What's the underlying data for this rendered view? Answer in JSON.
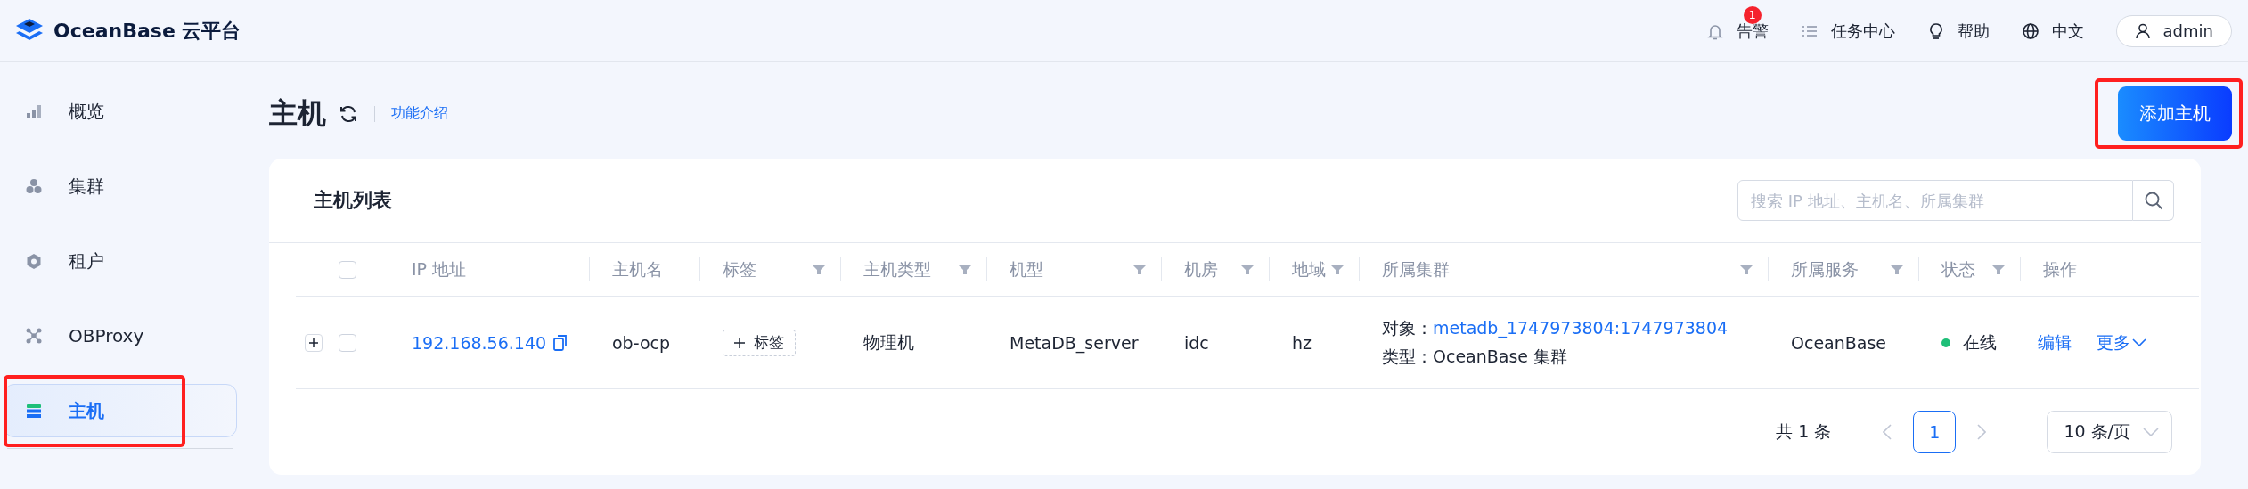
{
  "header": {
    "brand": "OceanBase 云平台",
    "actions": [
      {
        "kind": "alert",
        "label": "告警",
        "badge": "1"
      },
      {
        "kind": "tasks",
        "label": "任务中心"
      },
      {
        "kind": "help",
        "label": "帮助"
      },
      {
        "kind": "language",
        "label": "中文"
      }
    ],
    "user": "admin"
  },
  "sidebar": {
    "items": [
      {
        "kind": "overview",
        "label": "概览",
        "selected": false,
        "highlighted": false
      },
      {
        "kind": "cluster",
        "label": "集群",
        "selected": false,
        "highlighted": false
      },
      {
        "kind": "tenant",
        "label": "租户",
        "selected": false,
        "highlighted": false
      },
      {
        "kind": "proxy",
        "label": "OBProxy",
        "selected": false,
        "highlighted": false
      },
      {
        "kind": "host",
        "label": "主机",
        "selected": true,
        "highlighted": true
      }
    ]
  },
  "page": {
    "title": "主机",
    "intro_link": "功能介绍",
    "add_button": {
      "label": "添加主机",
      "highlighted": true
    }
  },
  "card": {
    "title": "主机列表",
    "search": {
      "placeholder": "搜索 IP 地址、主机名、所属集群"
    },
    "table": {
      "all_checked": false,
      "columns": [
        {
          "label": "IP 地址",
          "filter": false
        },
        {
          "label": "主机名",
          "filter": false
        },
        {
          "label": "标签",
          "filter": true
        },
        {
          "label": "主机类型",
          "filter": true
        },
        {
          "label": "机型",
          "filter": true
        },
        {
          "label": "机房",
          "filter": true
        },
        {
          "label": "地域",
          "filter": true
        },
        {
          "label": "所属集群",
          "filter": true
        },
        {
          "label": "所属服务",
          "filter": true
        },
        {
          "label": "状态",
          "filter": true
        },
        {
          "label": "操作",
          "filter": false
        }
      ],
      "rows": [
        {
          "expanded": false,
          "checked": false,
          "ip": "192.168.56.140",
          "hostname": "ob-ocp",
          "tag_button": "标签",
          "host_type": "物理机",
          "model": "MetaDB_server",
          "idc": "idc",
          "region": "hz",
          "cluster": {
            "object_label": "对象：",
            "object": "metadb_1747973804:1747973804",
            "type": "类型：OceanBase 集群"
          },
          "service": "OceanBase",
          "status": {
            "label": "在线",
            "color": "#1ebf78"
          },
          "actions": [
            "编辑",
            "更多"
          ]
        }
      ]
    },
    "pagination": {
      "total": "共 1 条",
      "pages": [
        {
          "label": "1",
          "selected": true
        }
      ],
      "page_size": "10 条/页"
    }
  }
}
